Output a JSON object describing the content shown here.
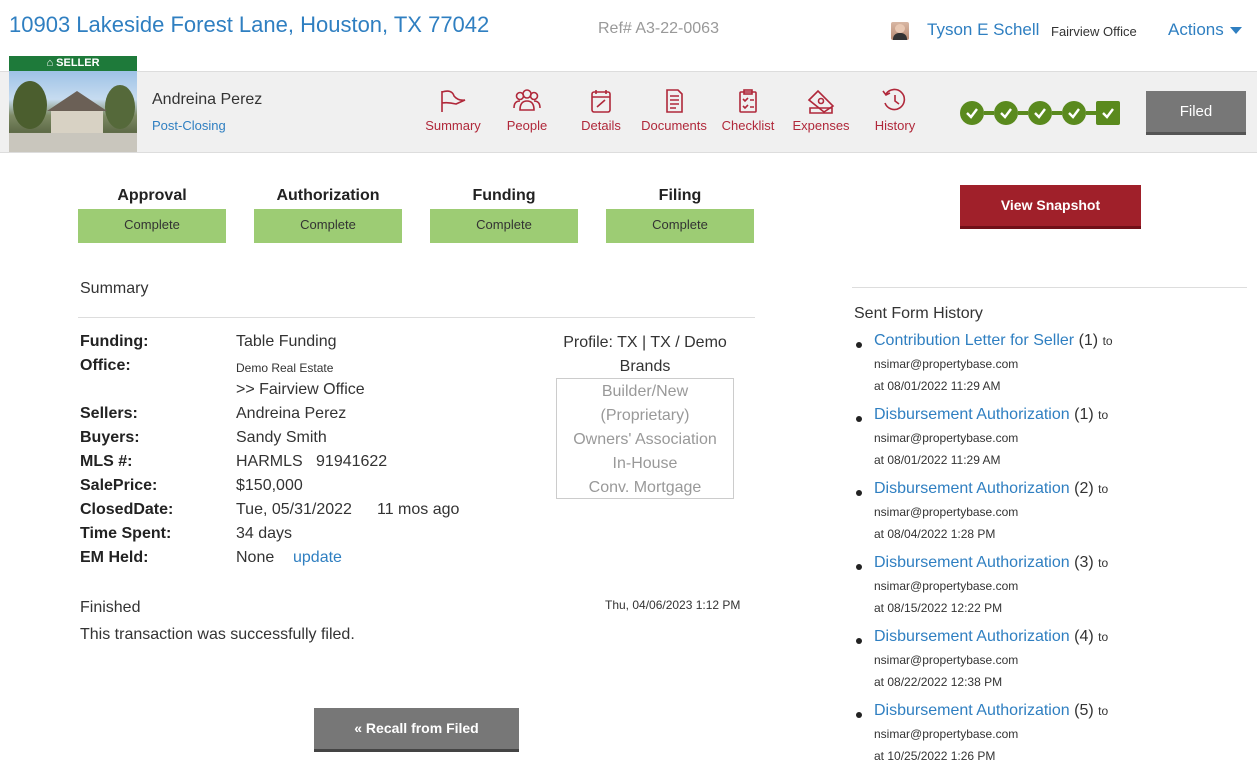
{
  "header": {
    "address": "10903 Lakeside Forest Lane, Houston, TX 77042",
    "ref": "Ref# A3-22-0063",
    "agent_name": "Tyson E Schell",
    "office": "Fairview Office",
    "actions_label": "Actions"
  },
  "listing": {
    "tag": "SELLER",
    "client_name": "Andreina Perez",
    "status": "Post-Closing"
  },
  "nav": {
    "items": [
      {
        "label": "Summary",
        "icon": "flag-icon"
      },
      {
        "label": "People",
        "icon": "people-icon"
      },
      {
        "label": "Details",
        "icon": "details-icon"
      },
      {
        "label": "Documents",
        "icon": "documents-icon"
      },
      {
        "label": "Checklist",
        "icon": "checklist-icon"
      },
      {
        "label": "Expenses",
        "icon": "expenses-icon"
      },
      {
        "label": "History",
        "icon": "history-icon"
      }
    ]
  },
  "progress": {
    "completed_steps": 5,
    "total_steps": 5
  },
  "filed_label": "Filed",
  "status_columns": [
    {
      "title": "Approval",
      "value": "Complete"
    },
    {
      "title": "Authorization",
      "value": "Complete"
    },
    {
      "title": "Funding",
      "value": "Complete"
    },
    {
      "title": "Filing",
      "value": "Complete"
    }
  ],
  "snapshot_button": "View Snapshot",
  "summary": {
    "heading": "Summary",
    "funding_label": "Funding:",
    "funding_value": "Table Funding",
    "office_label": "Office:",
    "office_value": "Demo Real Estate",
    "office_value2": ">> Fairview Office",
    "sellers_label": "Sellers:",
    "sellers_value": "Andreina Perez",
    "buyers_label": "Buyers:",
    "buyers_value": "Sandy Smith",
    "mls_label": "MLS #:",
    "mls_value": "HARMLS   91941622",
    "saleprice_label": "SalePrice:",
    "saleprice_value": "$150,000",
    "closed_label": "ClosedDate:",
    "closed_value": "Tue, 05/31/2022",
    "closed_ago": "11 mos ago",
    "timespent_label": "Time Spent:",
    "timespent_value": "34 days",
    "emheld_label": "EM Held:",
    "emheld_value": "None",
    "emheld_link": "update",
    "profile_label": "Profile: TX | TX / Demo Brands",
    "profile_options": [
      "Builder/New",
      "(Proprietary)",
      "Owners' Association",
      "In-House",
      "Conv. Mortgage"
    ]
  },
  "finished": {
    "heading": "Finished",
    "date": "Thu, 04/06/2023 1:12 PM",
    "message": "This transaction was successfully filed."
  },
  "recall_button": "« Recall from Filed",
  "sent_form_history": {
    "title": "Sent Form History",
    "items": [
      {
        "form": "Contribution Letter for Seller",
        "count": "(1)",
        "to": "to",
        "email": "nsimar@propertybase.com",
        "at": "at 08/01/2022 11:29 AM"
      },
      {
        "form": "Disbursement Authorization",
        "count": "(1)",
        "to": "to",
        "email": "nsimar@propertybase.com",
        "at": "at 08/01/2022 11:29 AM"
      },
      {
        "form": "Disbursement Authorization",
        "count": "(2)",
        "to": "to",
        "email": "nsimar@propertybase.com",
        "at": "at 08/04/2022 1:28 PM"
      },
      {
        "form": "Disbursement Authorization",
        "count": "(3)",
        "to": "to",
        "email": "nsimar@propertybase.com",
        "at": "at 08/15/2022 12:22 PM"
      },
      {
        "form": "Disbursement Authorization",
        "count": "(4)",
        "to": "to",
        "email": "nsimar@propertybase.com",
        "at": "at 08/22/2022 12:38 PM"
      },
      {
        "form": "Disbursement Authorization",
        "count": "(5)",
        "to": "to",
        "email": "nsimar@propertybase.com",
        "at": "at 10/25/2022 1:26 PM"
      }
    ]
  },
  "colors": {
    "link": "#2f7fc1",
    "accent_red": "#a0202a",
    "complete_green": "#9dcc74",
    "progress_green": "#5a8a1e"
  }
}
